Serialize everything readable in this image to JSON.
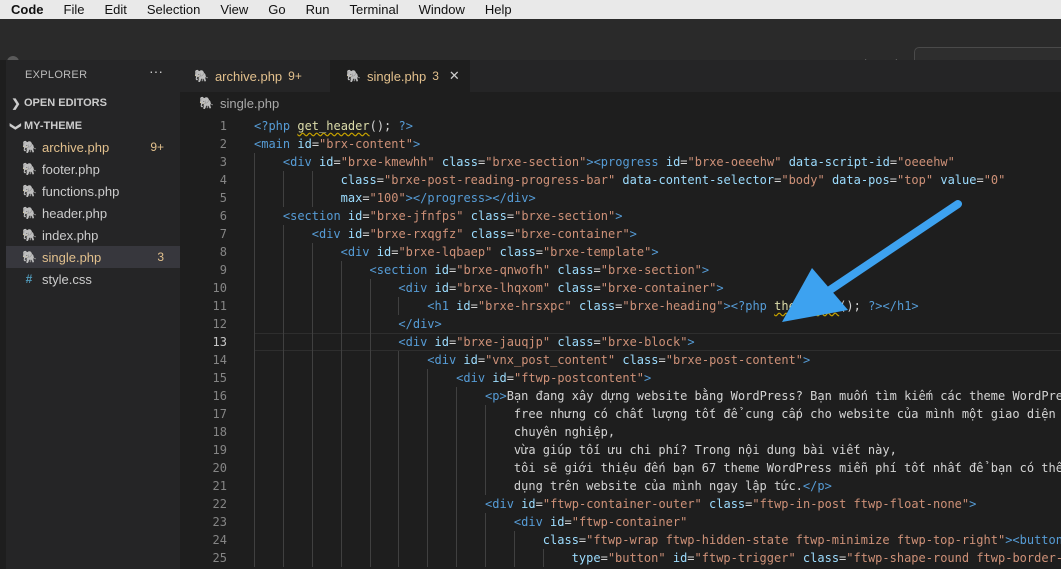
{
  "menubar": {
    "app": "Code",
    "items": [
      "File",
      "Edit",
      "Selection",
      "View",
      "Go",
      "Run",
      "Terminal",
      "Window",
      "Help"
    ]
  },
  "sidebar": {
    "title": "EXPLORER",
    "more": "···",
    "open_editors": "OPEN EDITORS",
    "folder": "MY-THEME",
    "files": [
      {
        "name": "archive.php",
        "badge": "9+",
        "icon": "php-elephant-icon",
        "modified": true
      },
      {
        "name": "footer.php",
        "badge": "",
        "icon": "php-elephant-icon",
        "modified": false
      },
      {
        "name": "functions.php",
        "badge": "",
        "icon": "php-elephant-icon",
        "modified": false
      },
      {
        "name": "header.php",
        "badge": "",
        "icon": "php-elephant-icon",
        "modified": false
      },
      {
        "name": "index.php",
        "badge": "",
        "icon": "php-elephant-icon",
        "modified": false
      },
      {
        "name": "single.php",
        "badge": "3",
        "icon": "php-elephant-icon",
        "modified": true,
        "active": true
      },
      {
        "name": "style.css",
        "badge": "",
        "icon": "hash-icon",
        "modified": false
      }
    ]
  },
  "tabs": [
    {
      "label": "archive.php",
      "count": "9+",
      "active": false
    },
    {
      "label": "single.php",
      "count": "3",
      "active": true,
      "close": "✕"
    }
  ],
  "breadcrumb": "single.php",
  "colors": {
    "modified": "#e2c08d",
    "tag": "#569cd6",
    "attr": "#9cdcfe",
    "string": "#ce9178",
    "func": "#dcdcaa",
    "arrow": "#3da2f0"
  },
  "editor": {
    "current_line": 13,
    "lines": [
      {
        "n": "1",
        "indent": 0,
        "segs": [
          [
            "p",
            "<?php "
          ],
          [
            "fsq",
            "get_header"
          ],
          [
            "w",
            "(); "
          ],
          [
            "p",
            "?>"
          ]
        ]
      },
      {
        "n": "2",
        "indent": 0,
        "segs": [
          [
            "t",
            "<main "
          ],
          [
            "a",
            "id"
          ],
          [
            "w",
            "="
          ],
          [
            "s",
            "\"brx-content\""
          ],
          [
            "t",
            ">"
          ]
        ]
      },
      {
        "n": "3",
        "indent": 1,
        "segs": [
          [
            "t",
            "<div "
          ],
          [
            "a",
            "id"
          ],
          [
            "w",
            "="
          ],
          [
            "s",
            "\"brxe-kmewhh\""
          ],
          [
            "w",
            " "
          ],
          [
            "a",
            "class"
          ],
          [
            "w",
            "="
          ],
          [
            "s",
            "\"brxe-section\""
          ],
          [
            "t",
            "><progress "
          ],
          [
            "a",
            "id"
          ],
          [
            "w",
            "="
          ],
          [
            "s",
            "\"brxe-oeeehw\""
          ],
          [
            "w",
            " "
          ],
          [
            "a",
            "data-script-id"
          ],
          [
            "w",
            "="
          ],
          [
            "s",
            "\"oeeehw\""
          ]
        ]
      },
      {
        "n": "4",
        "indent": 3,
        "segs": [
          [
            "a",
            "class"
          ],
          [
            "w",
            "="
          ],
          [
            "s",
            "\"brxe-post-reading-progress-bar\""
          ],
          [
            "w",
            " "
          ],
          [
            "a",
            "data-content-selector"
          ],
          [
            "w",
            "="
          ],
          [
            "s",
            "\"body\""
          ],
          [
            "w",
            " "
          ],
          [
            "a",
            "data-pos"
          ],
          [
            "w",
            "="
          ],
          [
            "s",
            "\"top\""
          ],
          [
            "w",
            " "
          ],
          [
            "a",
            "value"
          ],
          [
            "w",
            "="
          ],
          [
            "s",
            "\"0\""
          ]
        ]
      },
      {
        "n": "5",
        "indent": 3,
        "segs": [
          [
            "a",
            "max"
          ],
          [
            "w",
            "="
          ],
          [
            "s",
            "\"100\""
          ],
          [
            "t",
            "></progress></div>"
          ]
        ]
      },
      {
        "n": "6",
        "indent": 1,
        "segs": [
          [
            "t",
            "<section "
          ],
          [
            "a",
            "id"
          ],
          [
            "w",
            "="
          ],
          [
            "s",
            "\"brxe-jfnfps\""
          ],
          [
            "w",
            " "
          ],
          [
            "a",
            "class"
          ],
          [
            "w",
            "="
          ],
          [
            "s",
            "\"brxe-section\""
          ],
          [
            "t",
            ">"
          ]
        ]
      },
      {
        "n": "7",
        "indent": 2,
        "segs": [
          [
            "t",
            "<div "
          ],
          [
            "a",
            "id"
          ],
          [
            "w",
            "="
          ],
          [
            "s",
            "\"brxe-rxqgfz\""
          ],
          [
            "w",
            " "
          ],
          [
            "a",
            "class"
          ],
          [
            "w",
            "="
          ],
          [
            "s",
            "\"brxe-container\""
          ],
          [
            "t",
            ">"
          ]
        ]
      },
      {
        "n": "8",
        "indent": 3,
        "segs": [
          [
            "t",
            "<div "
          ],
          [
            "a",
            "id"
          ],
          [
            "w",
            "="
          ],
          [
            "s",
            "\"brxe-lqbaep\""
          ],
          [
            "w",
            " "
          ],
          [
            "a",
            "class"
          ],
          [
            "w",
            "="
          ],
          [
            "s",
            "\"brxe-template\""
          ],
          [
            "t",
            ">"
          ]
        ]
      },
      {
        "n": "9",
        "indent": 4,
        "segs": [
          [
            "t",
            "<section "
          ],
          [
            "a",
            "id"
          ],
          [
            "w",
            "="
          ],
          [
            "s",
            "\"brxe-qnwofh\""
          ],
          [
            "w",
            " "
          ],
          [
            "a",
            "class"
          ],
          [
            "w",
            "="
          ],
          [
            "s",
            "\"brxe-section\""
          ],
          [
            "t",
            ">"
          ]
        ]
      },
      {
        "n": "10",
        "indent": 5,
        "segs": [
          [
            "t",
            "<div "
          ],
          [
            "a",
            "id"
          ],
          [
            "w",
            "="
          ],
          [
            "s",
            "\"brxe-lhqxom\""
          ],
          [
            "w",
            " "
          ],
          [
            "a",
            "class"
          ],
          [
            "w",
            "="
          ],
          [
            "s",
            "\"brxe-container\""
          ],
          [
            "t",
            ">"
          ]
        ]
      },
      {
        "n": "11",
        "indent": 6,
        "segs": [
          [
            "t",
            "<h1 "
          ],
          [
            "a",
            "id"
          ],
          [
            "w",
            "="
          ],
          [
            "s",
            "\"brxe-hrsxpc\""
          ],
          [
            "w",
            " "
          ],
          [
            "a",
            "class"
          ],
          [
            "w",
            "="
          ],
          [
            "s",
            "\"brxe-heading\""
          ],
          [
            "t",
            ">"
          ],
          [
            "p",
            "<?php "
          ],
          [
            "fsq",
            "the_title"
          ],
          [
            "w",
            "(); "
          ],
          [
            "p",
            "?>"
          ],
          [
            "t",
            "</h1>"
          ]
        ]
      },
      {
        "n": "12",
        "indent": 5,
        "segs": [
          [
            "t",
            "</div>"
          ]
        ]
      },
      {
        "n": "13",
        "indent": 5,
        "segs": [
          [
            "t",
            "<div "
          ],
          [
            "a",
            "id"
          ],
          [
            "w",
            "="
          ],
          [
            "s",
            "\"brxe-jauqjp\""
          ],
          [
            "w",
            " "
          ],
          [
            "a",
            "class"
          ],
          [
            "w",
            "="
          ],
          [
            "s",
            "\"brxe-block\""
          ],
          [
            "t",
            ">"
          ]
        ]
      },
      {
        "n": "14",
        "indent": 6,
        "segs": [
          [
            "t",
            "<div "
          ],
          [
            "a",
            "id"
          ],
          [
            "w",
            "="
          ],
          [
            "s",
            "\"vnx_post_content\""
          ],
          [
            "w",
            " "
          ],
          [
            "a",
            "class"
          ],
          [
            "w",
            "="
          ],
          [
            "s",
            "\"brxe-post-content\""
          ],
          [
            "t",
            ">"
          ]
        ]
      },
      {
        "n": "15",
        "indent": 7,
        "segs": [
          [
            "t",
            "<div "
          ],
          [
            "a",
            "id"
          ],
          [
            "w",
            "="
          ],
          [
            "s",
            "\"ftwp-postcontent\""
          ],
          [
            "t",
            ">"
          ]
        ]
      },
      {
        "n": "16",
        "indent": 8,
        "segs": [
          [
            "t",
            "<p>"
          ],
          [
            "w",
            "Bạn đang xây dựng website bằng WordPress? Bạn muốn tìm kiếm các theme WordPress"
          ]
        ]
      },
      {
        "n": "17",
        "indent": 9,
        "segs": [
          [
            "w",
            "free nhưng có chất lượng tốt để cung cấp cho website của mình một giao diện"
          ]
        ]
      },
      {
        "n": "18",
        "indent": 9,
        "segs": [
          [
            "w",
            "chuyên nghiệp,"
          ]
        ]
      },
      {
        "n": "19",
        "indent": 9,
        "segs": [
          [
            "w",
            "vừa giúp tối ưu chi phí? Trong nội dung bài viết này,"
          ]
        ]
      },
      {
        "n": "20",
        "indent": 9,
        "segs": [
          [
            "w",
            "tôi sẽ giới thiệu đến bạn 67 theme WordPress miễn phí tốt nhất để bạn có thể"
          ]
        ]
      },
      {
        "n": "21",
        "indent": 9,
        "segs": [
          [
            "w",
            "dụng trên website của mình ngay lập tức."
          ],
          [
            "t",
            "</p>"
          ]
        ]
      },
      {
        "n": "22",
        "indent": 8,
        "segs": [
          [
            "t",
            "<div "
          ],
          [
            "a",
            "id"
          ],
          [
            "w",
            "="
          ],
          [
            "s",
            "\"ftwp-container-outer\""
          ],
          [
            "w",
            " "
          ],
          [
            "a",
            "class"
          ],
          [
            "w",
            "="
          ],
          [
            "s",
            "\"ftwp-in-post ftwp-float-none\""
          ],
          [
            "t",
            ">"
          ]
        ]
      },
      {
        "n": "23",
        "indent": 9,
        "segs": [
          [
            "t",
            "<div "
          ],
          [
            "a",
            "id"
          ],
          [
            "w",
            "="
          ],
          [
            "s",
            "\"ftwp-container\""
          ]
        ]
      },
      {
        "n": "24",
        "indent": 10,
        "segs": [
          [
            "a",
            "class"
          ],
          [
            "w",
            "="
          ],
          [
            "s",
            "\"ftwp-wrap ftwp-hidden-state ftwp-minimize ftwp-top-right\""
          ],
          [
            "t",
            "><button"
          ]
        ]
      },
      {
        "n": "25",
        "indent": 11,
        "segs": [
          [
            "a",
            "type"
          ],
          [
            "w",
            "="
          ],
          [
            "s",
            "\"button\""
          ],
          [
            "w",
            " "
          ],
          [
            "a",
            "id"
          ],
          [
            "w",
            "="
          ],
          [
            "s",
            "\"ftwp-trigger\""
          ],
          [
            "w",
            " "
          ],
          [
            "a",
            "class"
          ],
          [
            "w",
            "="
          ],
          [
            "s",
            "\"ftwp-shape-round ftwp-border-"
          ]
        ]
      }
    ]
  }
}
